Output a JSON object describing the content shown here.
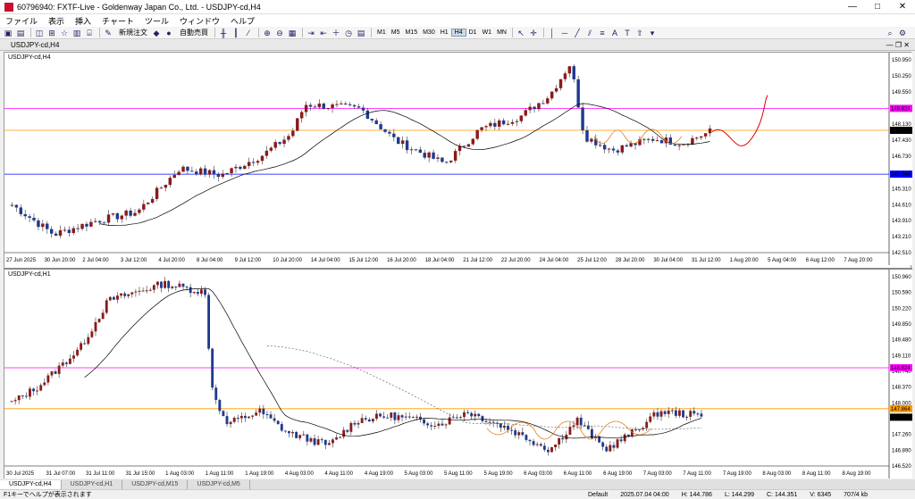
{
  "window": {
    "title": "60796940: FXTF-Live - Goldenway Japan Co., Ltd. - USDJPY-cd,H4",
    "controls": [
      "—",
      "□",
      "✕"
    ]
  },
  "menu": [
    "ファイル",
    "表示",
    "挿入",
    "チャート",
    "ツール",
    "ウィンドウ",
    "ヘルプ"
  ],
  "toolbar": {
    "new_order": "新規注文",
    "auto_trade": "自動売買",
    "periods": [
      "M1",
      "M5",
      "M15",
      "M30",
      "H1",
      "H4",
      "D1",
      "W1",
      "MN"
    ],
    "active_period": "H4"
  },
  "child_window": {
    "title": "USDJPY-cd,H4"
  },
  "charts": [
    {
      "label": "USDJPY-cd,H4",
      "price_ticks": [
        "150.950",
        "150.250",
        "149.550",
        "148.130",
        "147.430",
        "146.730",
        "146.010",
        "145.310",
        "144.610",
        "143.910",
        "143.210",
        "142.510"
      ],
      "time_ticks": [
        "27 Jun 2025",
        "30 Jun 20:00",
        "2 Jul 04:00",
        "3 Jul 12:00",
        "4 Jul 20:00",
        "8 Jul 04:00",
        "9 Jul 12:00",
        "10 Jul 20:00",
        "14 Jul 04:00",
        "15 Jul 12:00",
        "16 Jul 20:00",
        "18 Jul 04:00",
        "21 Jul 12:00",
        "22 Jul 20:00",
        "24 Jul 04:00",
        "25 Jul 12:00",
        "28 Jul 20:00",
        "30 Jul 04:00",
        "31 Jul 12:00",
        "1 Aug 20:00",
        "5 Aug 04:00",
        "6 Aug 12:00",
        "7 Aug 20:00"
      ],
      "levels": [
        {
          "price": "148.824",
          "color": "#ff00ff"
        },
        {
          "price": "147.864",
          "color": "#ff9900"
        },
        {
          "price": "145.944",
          "color": "#0000ff"
        }
      ],
      "current_price": "147.864"
    },
    {
      "label": "USDJPY-cd,H1",
      "price_ticks": [
        "150.960",
        "150.590",
        "150.220",
        "149.850",
        "149.480",
        "149.110",
        "148.740",
        "148.370",
        "148.000",
        "147.630",
        "147.260",
        "146.890",
        "146.520"
      ],
      "time_ticks": [
        "30 Jul 2025",
        "31 Jul 07:00",
        "31 Jul 11:00",
        "31 Jul 15:00",
        "1 Aug 03:00",
        "1 Aug 11:00",
        "1 Aug 19:00",
        "4 Aug 03:00",
        "4 Aug 11:00",
        "4 Aug 19:00",
        "5 Aug 03:00",
        "5 Aug 11:00",
        "5 Aug 19:00",
        "6 Aug 03:00",
        "6 Aug 11:00",
        "6 Aug 19:00",
        "7 Aug 03:00",
        "7 Aug 11:00",
        "7 Aug 19:00",
        "8 Aug 03:00",
        "8 Aug 11:00",
        "8 Aug 19:00"
      ],
      "levels": [
        {
          "price": "148.824",
          "color": "#ff00ff"
        },
        {
          "price": "147.864",
          "color": "#ff9900"
        }
      ],
      "current_price": "147.664"
    }
  ],
  "tabs": [
    "USDJPY-cd,H4",
    "USDJPY-cd,H1",
    "USDJPY-cd,M15",
    "USDJPY-cd,M5"
  ],
  "active_tab": "USDJPY-cd,H4",
  "status": {
    "help": "F1キーでヘルプが表示されます",
    "profile": "Default",
    "datetime": "2025.07.04 04:00",
    "high": "H: 144.786",
    "low": "L: 144.299",
    "close": "C: 144.351",
    "volume": "V: 6345",
    "traffic": "707/4 kb"
  },
  "colors": {
    "bull": "#8b1a1a",
    "bear": "#1f3a8f",
    "ma": "#000000",
    "projection": "#e00000",
    "pattern": "#e08020"
  }
}
